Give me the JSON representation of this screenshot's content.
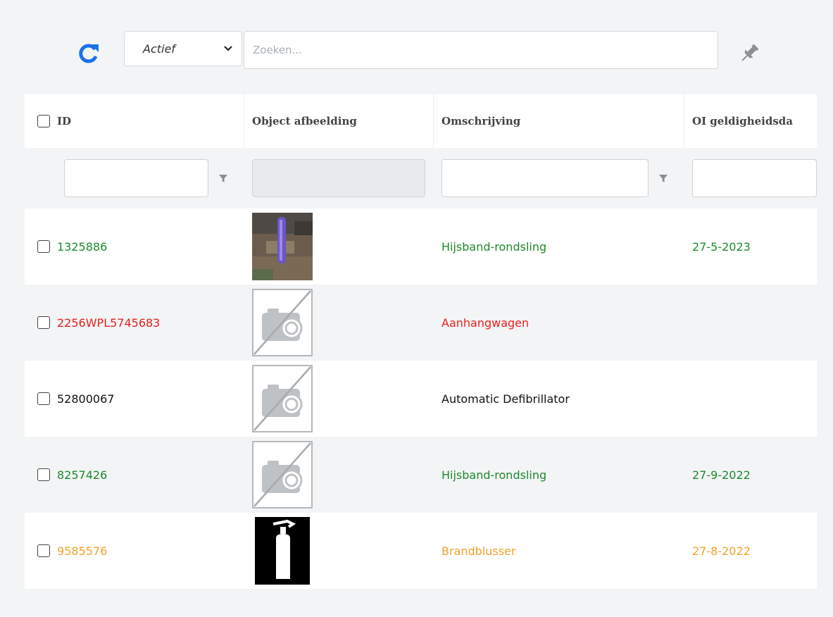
{
  "toolbar": {
    "status_value": "Actief",
    "search_placeholder": "Zoeken..."
  },
  "columns": [
    "ID",
    "Object afbeelding",
    "Omschrijving",
    "OI geldigheidsda"
  ],
  "colors": {
    "green": "#1e8a2e",
    "red": "#e8201c",
    "black": "#111111",
    "orange": "#f2a12a",
    "refresh_blue": "#1a73e8"
  },
  "rows": [
    {
      "id": "1325886",
      "image": "photo-thumbnail",
      "description": "Hijsband-rondsling",
      "date": "27-5-2023",
      "status_color": "green"
    },
    {
      "id": "2256WPL5745683",
      "image": "no-photo-icon",
      "description": "Aanhangwagen",
      "date": "",
      "status_color": "red"
    },
    {
      "id": "52800067",
      "image": "no-photo-icon",
      "description": "Automatic Defibrillator",
      "date": "",
      "status_color": "black"
    },
    {
      "id": "8257426",
      "image": "no-photo-icon",
      "description": "Hijsband-rondsling",
      "date": "27-9-2022",
      "status_color": "green"
    },
    {
      "id": "9585576",
      "image": "fire-extinguisher-icon",
      "description": "Brandblusser",
      "date": "27-8-2022",
      "status_color": "orange"
    }
  ]
}
